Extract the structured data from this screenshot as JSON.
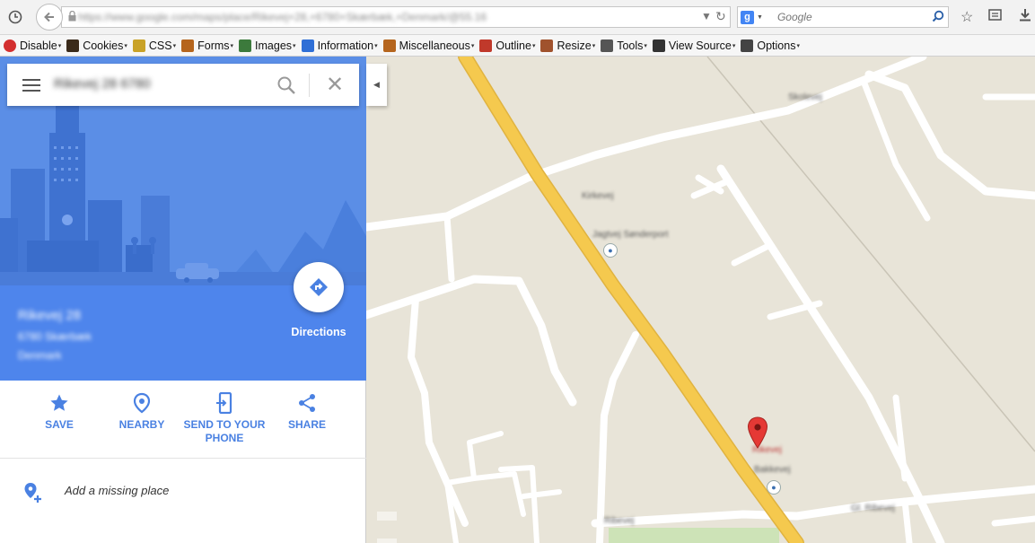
{
  "browser": {
    "url": "https://www.google.com/maps/place/Rikevej+28,+6780+Skærbæk,+Denmark/@55.16",
    "search_engine_badge": "g",
    "search_placeholder": "Google"
  },
  "toolbar": {
    "items": [
      {
        "label": "Disable",
        "icon": "disable-icon",
        "color": "#d32f2f"
      },
      {
        "label": "Cookies",
        "icon": "cookies-icon",
        "color": "#3a2a1a"
      },
      {
        "label": "CSS",
        "icon": "css-icon",
        "color": "#c9a227"
      },
      {
        "label": "Forms",
        "icon": "forms-icon",
        "color": "#b5651d"
      },
      {
        "label": "Images",
        "icon": "images-icon",
        "color": "#3c7a3c"
      },
      {
        "label": "Information",
        "icon": "information-icon",
        "color": "#2f6fd6"
      },
      {
        "label": "Miscellaneous",
        "icon": "miscellaneous-icon",
        "color": "#b5651d"
      },
      {
        "label": "Outline",
        "icon": "outline-icon",
        "color": "#c0392b"
      },
      {
        "label": "Resize",
        "icon": "resize-icon",
        "color": "#a0522d"
      },
      {
        "label": "Tools",
        "icon": "tools-icon",
        "color": "#555555"
      },
      {
        "label": "View Source",
        "icon": "view-source-icon",
        "color": "#333333"
      },
      {
        "label": "Options",
        "icon": "options-icon",
        "color": "#444444"
      }
    ]
  },
  "panel": {
    "search_query": "Rikevej 28 6780",
    "address_line1": "Rikevej 28",
    "address_line2": "6780 Skærbæk",
    "address_line3": "Denmark",
    "directions_label": "Directions",
    "actions": [
      {
        "label": "SAVE",
        "icon": "star-icon"
      },
      {
        "label": "NEARBY",
        "icon": "nearby-pin-icon"
      },
      {
        "label": "SEND TO YOUR PHONE",
        "icon": "send-to-phone-icon"
      },
      {
        "label": "SHARE",
        "icon": "share-icon"
      }
    ],
    "add_missing_place": "Add a missing place"
  },
  "map": {
    "labels": [
      "Jagtvej Sønderport",
      "Rikevej",
      "Bakkevej",
      "Skolevej",
      "Ribevej",
      "Kirkevej",
      "Gl. Ribevej"
    ],
    "colors": {
      "land": "#e8e4d8",
      "main_road": "#f5c94e",
      "minor_road": "#ffffff",
      "park": "#cde3b7",
      "pin": "#e53935"
    }
  }
}
